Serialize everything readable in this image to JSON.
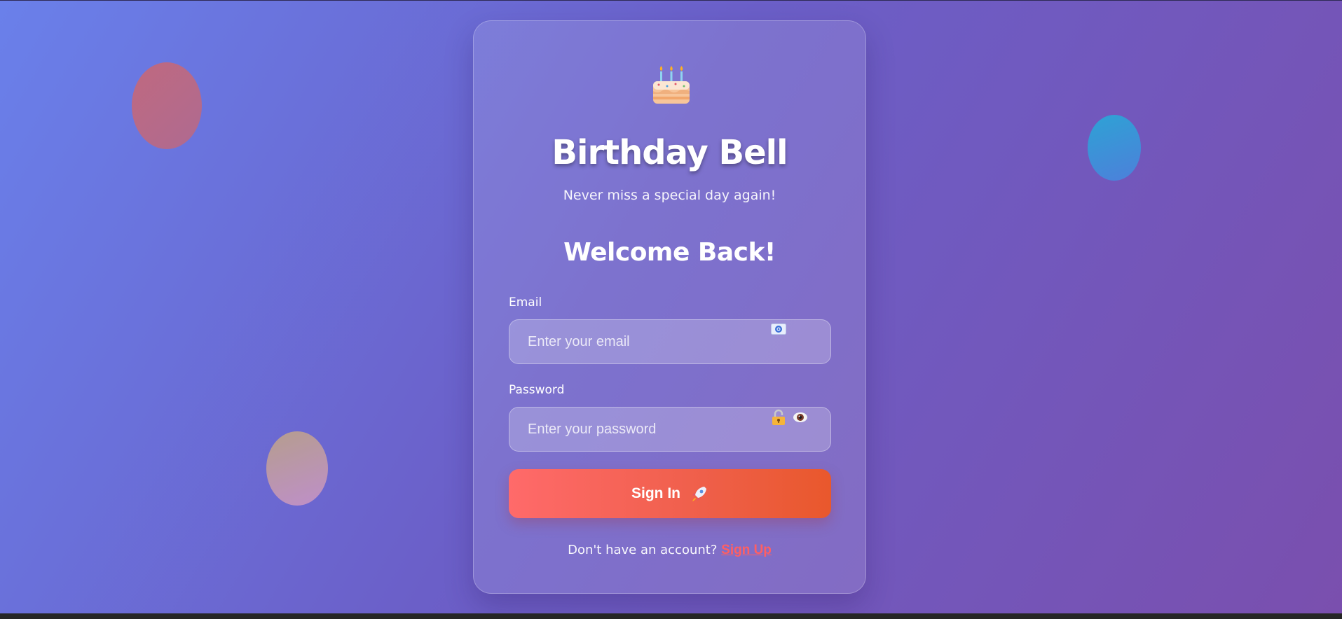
{
  "app": {
    "title": "Birthday Bell",
    "tagline": "Never miss a special day again!"
  },
  "form": {
    "heading": "Welcome Back!",
    "email": {
      "label": "Email",
      "placeholder": "Enter your email",
      "value": "",
      "icon": "at-sign-icon"
    },
    "password": {
      "label": "Password",
      "placeholder": "Enter your password",
      "value": "",
      "icons": [
        "lock-icon",
        "eye-icon"
      ]
    },
    "submit": {
      "label": "Sign In",
      "icon": "rocket-icon"
    }
  },
  "footer": {
    "prompt": "Don't have an account?",
    "link": "Sign Up"
  },
  "colors": {
    "background_start": "#6a80ea",
    "background_end": "#7a4fae",
    "button_start": "#ff6a6a",
    "button_end": "#e9582c",
    "link": "#ff5f63"
  },
  "decor": {
    "logo_icon": "birthday-cake-icon",
    "balloons": [
      "balloon-red",
      "balloon-peach",
      "balloon-blue"
    ]
  }
}
